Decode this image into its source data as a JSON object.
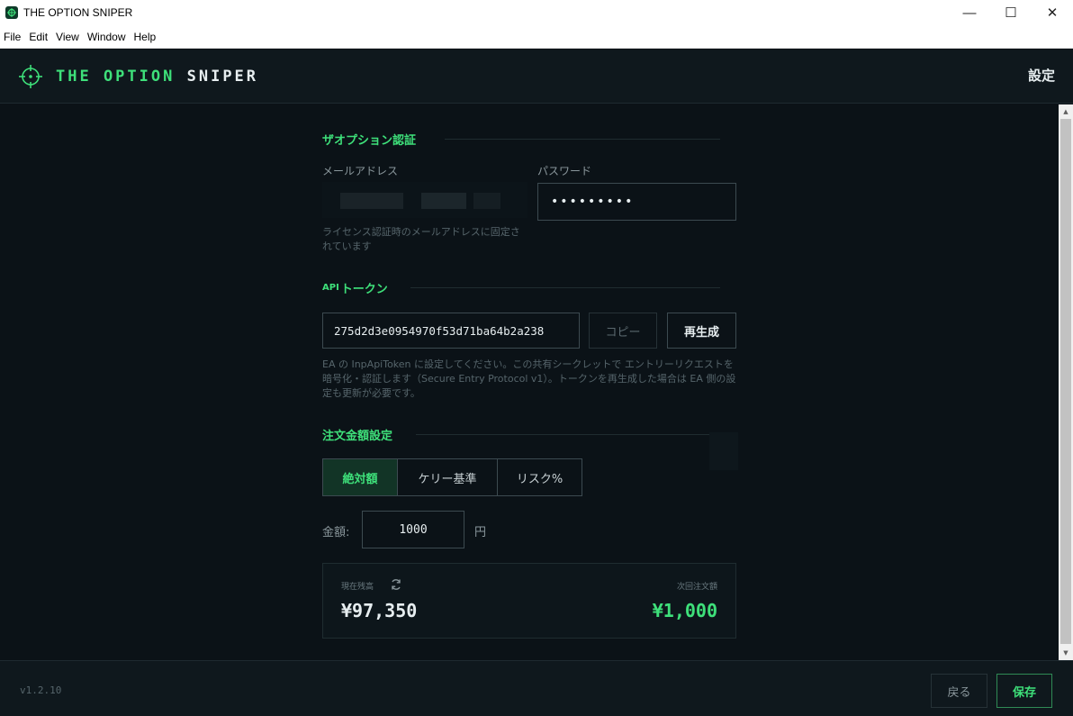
{
  "window": {
    "title": "THE OPTION SNIPER",
    "minimize_glyph": "—",
    "maximize_glyph": "☐",
    "close_glyph": "✕"
  },
  "menu": [
    "File",
    "Edit",
    "View",
    "Window",
    "Help"
  ],
  "header": {
    "brand_part1": "THE OPTION",
    "brand_part2": "SNIPER",
    "page_title": "設定"
  },
  "auth": {
    "title": "ザオプション認証",
    "email_label": "メールアドレス",
    "email_hint": "ライセンス認証時のメールアドレスに固定されています",
    "password_label": "パスワード",
    "password_value": "•••••••••"
  },
  "api": {
    "title_prefix": "API",
    "title_suffix": "トークン",
    "token_value": "275d2d3e0954970f53d71ba64b2a238",
    "copy_label": "コピー",
    "regen_label": "再生成",
    "hint": "EA の InpApiToken に設定してください。この共有シークレットで エントリーリクエストを暗号化・認証します（Secure Entry Protocol v1）。トークンを再生成した場合は EA 側の設定も更新が必要です。"
  },
  "order": {
    "title": "注文金額設定",
    "modes": [
      "絶対額",
      "ケリー基準",
      "リスク%"
    ],
    "active_mode": "絶対額",
    "amount_label": "金額:",
    "amount_value": "1000",
    "amount_unit": "円",
    "balance_label": "現在残高",
    "balance_value": "¥97,350",
    "next_label": "次回注文額",
    "next_value": "¥1,000"
  },
  "footer": {
    "version": "v1.2.10",
    "back_label": "戻る",
    "save_label": "保存"
  },
  "colors": {
    "accent": "#3ee07a",
    "background": "#0b1217",
    "panel": "#0f181d",
    "border": "#3c4a50"
  }
}
